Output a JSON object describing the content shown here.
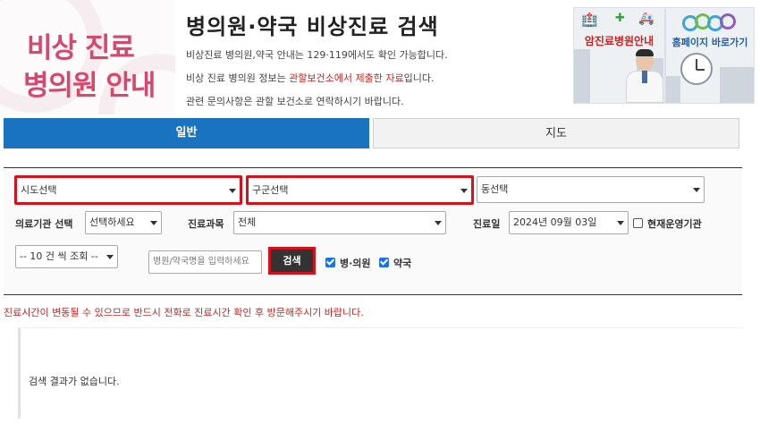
{
  "header": {
    "hero_line1": "비상 진료",
    "hero_line2": "병의원 안내",
    "title": "병의원·약국 비상진료 검색",
    "info1": "비상진료 병의원,약국 안내는 129·119에서도 확인 가능합니다.",
    "info2_pre": "비상 진료 병의원 정보는 ",
    "info2_hl": "관할보건소에서 제출한 자료",
    "info2_post": "입니다.",
    "info3": "관련 문의사항은 관할 보건소로 연락하시기 바랍니다."
  },
  "banners": {
    "cancer_hospital": "암진료병원안내",
    "homepage": "홈페이지 바로가기"
  },
  "tabs": [
    {
      "label": "일반",
      "active": true
    },
    {
      "label": "지도",
      "active": false
    }
  ],
  "filters": {
    "sido": "시도선택",
    "gugun": "구군선택",
    "dong": "동선택",
    "institution_label": "의료기관 선택",
    "institution_value": "선택하세요",
    "dept_label": "진료과목",
    "dept_value": "전체",
    "date_label": "진료일",
    "date_value": "2024년 09월 03일",
    "open_now_label": "현재운영기관",
    "open_now_checked": false,
    "page_size": "-- 10 건 씩 조회 --",
    "name_placeholder": "병원/약국명을 입력하세요",
    "search_button": "검색",
    "hospital_label": "병·의원",
    "hospital_checked": true,
    "pharmacy_label": "약국",
    "pharmacy_checked": true
  },
  "notice": "진료시간이 변동될 수 있으므로 반드시 전화로 진료시간 확인 후 방문해주시기 바랍니다.",
  "result": {
    "empty_message": "검색 결과가 없습니다."
  },
  "colors": {
    "accent": "#1a73c0",
    "hero_text": "#d44a6e",
    "highlight": "#d21f1f",
    "required_outline": "#d8101c"
  }
}
